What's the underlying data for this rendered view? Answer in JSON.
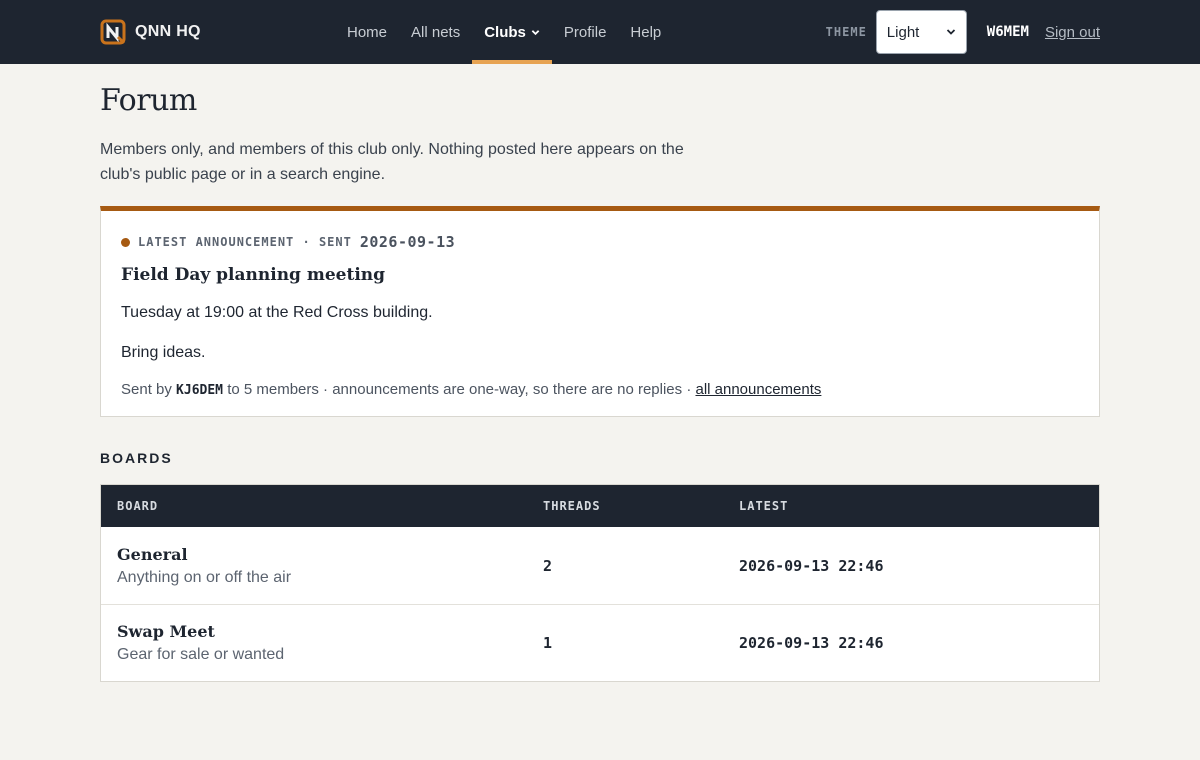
{
  "brand": {
    "name": "QNN HQ",
    "logo_icon": "qnn-logo-icon"
  },
  "nav": {
    "items": [
      {
        "label": "Home",
        "active": false
      },
      {
        "label": "All nets",
        "active": false
      },
      {
        "label": "Clubs",
        "active": true
      },
      {
        "label": "Profile",
        "active": false
      },
      {
        "label": "Help",
        "active": false
      }
    ]
  },
  "theme": {
    "label": "THEME",
    "selected": "Light"
  },
  "user": {
    "callsign": "W6MEM",
    "sign_out_label": "Sign out"
  },
  "page": {
    "title": "Forum",
    "intro": "Members only, and members of this club only. Nothing posted here appears on the club's public page or in a search engine."
  },
  "announcement": {
    "kicker": "LATEST ANNOUNCEMENT · SENT",
    "date": "2026-09-13",
    "title": "Field Day planning meeting",
    "body": [
      "Tuesday at 19:00 at the Red Cross building.",
      "Bring ideas."
    ],
    "footer_prefix": "Sent by",
    "sender": "KJ6DEM",
    "footer_middle": "to 5 members · announcements are one-way, so there are no replies ·",
    "footer_link": "all announcements"
  },
  "boards": {
    "section_title": "BOARDS",
    "columns": [
      "BOARD",
      "THREADS",
      "LATEST"
    ],
    "rows": [
      {
        "name": "General",
        "description": "Anything on or off the air",
        "threads": "2",
        "latest": "2026-09-13 22:46"
      },
      {
        "name": "Swap Meet",
        "description": "Gear for sale or wanted",
        "threads": "1",
        "latest": "2026-09-13 22:46"
      }
    ]
  },
  "colors": {
    "topbar": "#1e2530",
    "accent": "#a65a12",
    "nav_active_underline": "#e7a352",
    "page_background": "#f4f3ef"
  }
}
